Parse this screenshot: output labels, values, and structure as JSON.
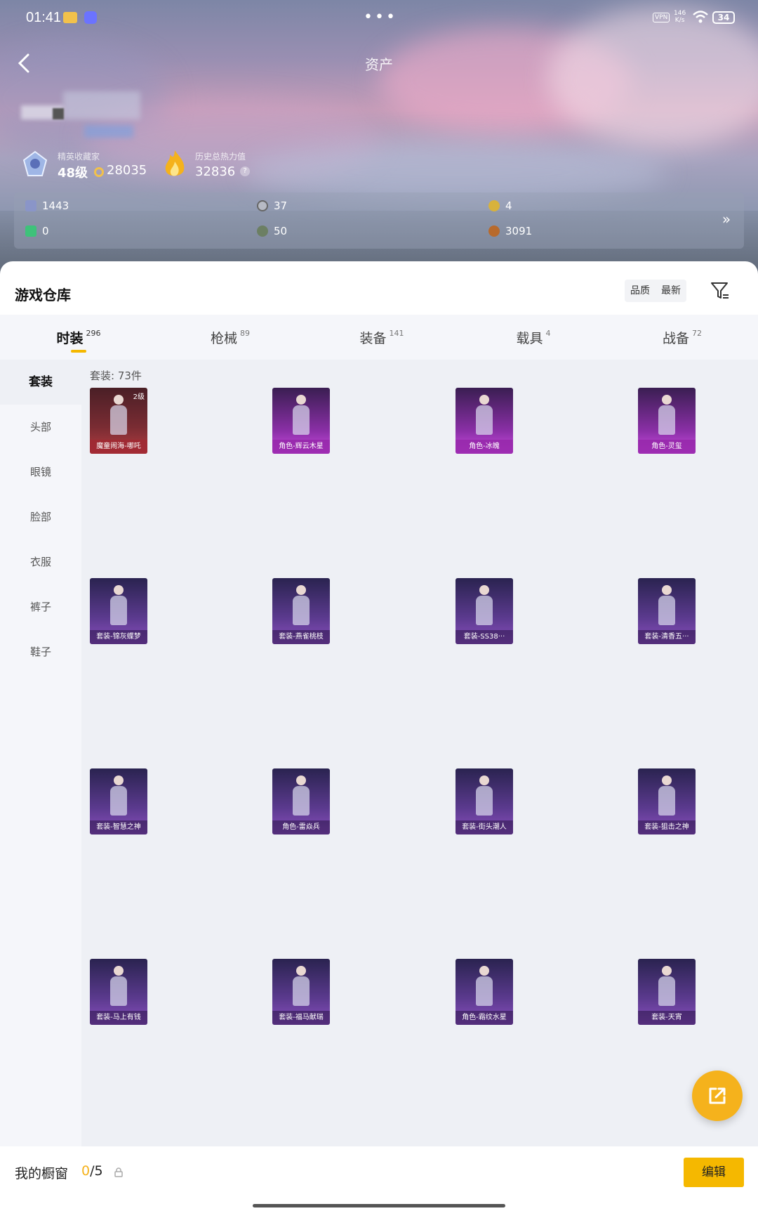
{
  "status_bar": {
    "time": "01:41",
    "vpn": "VPN",
    "speed_value": "146",
    "speed_unit": "K/s",
    "battery": "34"
  },
  "nav": {
    "title": "资产"
  },
  "profile": {
    "rank_title": "精英收藏家",
    "rank_level": "48级",
    "coins": "28035",
    "heat_label": "历史总热力值",
    "heat_value": "32836",
    "help": "?"
  },
  "stats": [
    "1443",
    "37",
    "4",
    "0",
    "50",
    "3091"
  ],
  "stats_more": "»",
  "warehouse": {
    "title": "游戏仓库",
    "sort_quality": "品质",
    "sort_latest": "最新"
  },
  "tabs": [
    {
      "label": "时装",
      "count": "296"
    },
    {
      "label": "枪械",
      "count": "89"
    },
    {
      "label": "装备",
      "count": "141"
    },
    {
      "label": "载具",
      "count": "4"
    },
    {
      "label": "战备",
      "count": "72"
    }
  ],
  "sidebar": [
    "套装",
    "头部",
    "眼镜",
    "脸部",
    "衣服",
    "裤子",
    "鞋子"
  ],
  "content": {
    "count_label": "套装: 73件",
    "items": [
      {
        "name": "魔童闹海-哪吒",
        "level": "2级",
        "rarity": "red"
      },
      {
        "name": "角色-辉云木星",
        "level": "",
        "rarity": "magenta"
      },
      {
        "name": "角色-冰魄",
        "level": "",
        "rarity": "magenta"
      },
      {
        "name": "角色-灵玺",
        "level": "",
        "rarity": "magenta"
      },
      {
        "name": "套装-锦灰蝶梦",
        "level": "",
        "rarity": "purple"
      },
      {
        "name": "套装-燕雀桃枝",
        "level": "",
        "rarity": "purple"
      },
      {
        "name": "套装-SS38···",
        "level": "",
        "rarity": "purple"
      },
      {
        "name": "套装-清香五···",
        "level": "",
        "rarity": "purple"
      },
      {
        "name": "套装-智慧之神",
        "level": "",
        "rarity": "purple"
      },
      {
        "name": "角色-雷焱兵",
        "level": "",
        "rarity": "purple"
      },
      {
        "name": "套装-街头潮人",
        "level": "",
        "rarity": "purple"
      },
      {
        "name": "套装-狙击之神",
        "level": "",
        "rarity": "purple"
      },
      {
        "name": "套装-马上有钱",
        "level": "",
        "rarity": "purple"
      },
      {
        "name": "套装-福马献瑞",
        "level": "",
        "rarity": "purple"
      },
      {
        "name": "角色-霜纹水星",
        "level": "",
        "rarity": "purple"
      },
      {
        "name": "套装-天宵",
        "level": "",
        "rarity": "purple"
      }
    ]
  },
  "shelf": {
    "label": "我的橱窗",
    "current": "0",
    "total": "/5",
    "edit": "编辑"
  },
  "colors": {
    "accent": "#f5b800",
    "fab": "#f5b21c"
  }
}
